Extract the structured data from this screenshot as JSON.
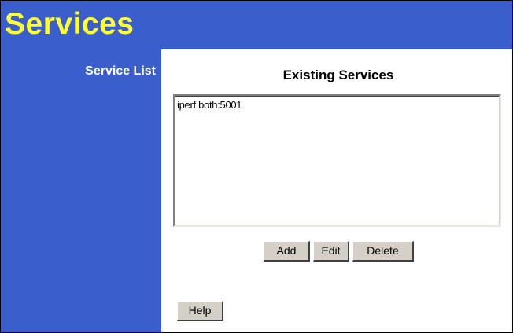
{
  "header": {
    "title": "Services"
  },
  "sidebar": {
    "label": "Service List"
  },
  "main": {
    "section_title": "Existing Services",
    "services_list": {
      "items": [
        "iperf both:5001"
      ]
    },
    "buttons": {
      "add": "Add",
      "edit": "Edit",
      "delete": "Delete",
      "help": "Help"
    }
  },
  "colors": {
    "header_bg": "#3a5fcd",
    "title_text": "#ffff33",
    "sidebar_text": "#ffffff",
    "button_face": "#d4d0c8"
  }
}
